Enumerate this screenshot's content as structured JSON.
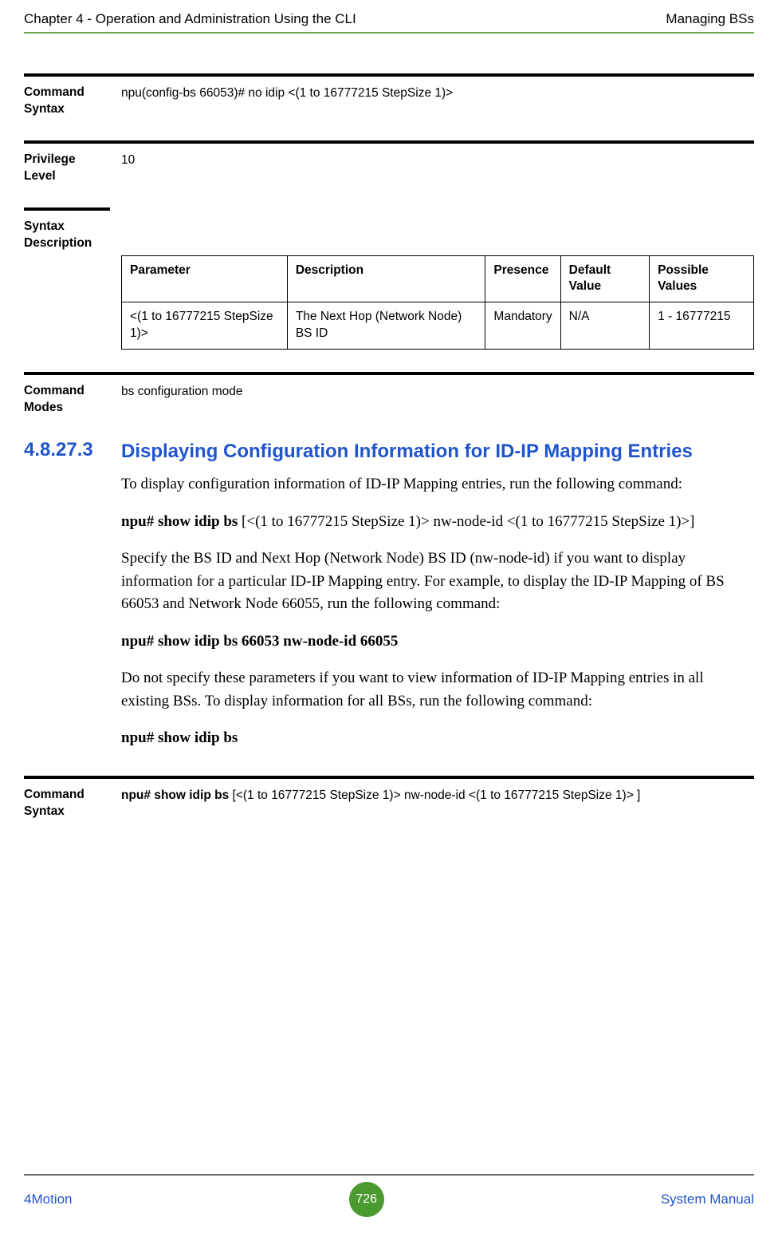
{
  "header": {
    "left": "Chapter 4 - Operation and Administration Using the CLI",
    "right": "Managing BSs"
  },
  "blocks": {
    "command_syntax_1": {
      "label": "Command Syntax",
      "value": "npu(config-bs 66053)#  no idip <(1 to 16777215 StepSize 1)>"
    },
    "privilege_level": {
      "label": "Privilege Level",
      "value": "10"
    },
    "syntax_description": {
      "label": "Syntax Description"
    },
    "command_modes": {
      "label": "Command Modes",
      "value": "bs configuration mode"
    },
    "command_syntax_2": {
      "label": "Command Syntax",
      "value_bold": "npu# show idip bs",
      "value_rest": " [<(1 to 16777215 StepSize 1)> nw-node-id <(1 to 16777215 StepSize 1)> ]"
    }
  },
  "param_table": {
    "headers": {
      "parameter": "Parameter",
      "description": "Description",
      "presence": "Presence",
      "default": "Default Value",
      "possible": "Possible Values"
    },
    "row": {
      "parameter": "<(1 to 16777215 StepSize 1)>",
      "description": "The Next Hop (Network Node) BS ID",
      "presence": "Mandatory",
      "default": "N/A",
      "possible": "1 - 16777215"
    }
  },
  "section": {
    "number": "4.8.27.3",
    "title": "Displaying Configuration Information for ID-IP Mapping Entries"
  },
  "paragraphs": {
    "p1": "To display configuration information of ID-IP Mapping entries, run the following command:",
    "p2_bold": "npu# show idip bs",
    "p2_rest": " [<(1 to 16777215 StepSize 1)> nw-node-id <(1 to 16777215 StepSize 1)>]",
    "p3": "Specify the BS ID and Next Hop (Network Node) BS ID (nw-node-id) if you want to display information for a particular ID-IP Mapping entry. For example, to display the ID-IP Mapping of BS 66053 and Network Node 66055, run the following command:",
    "p4_bold": "npu# show idip bs 66053 nw-node-id 66055",
    "p5": "Do not specify these parameters if you want to view information of ID-IP Mapping entries in all existing BSs. To display information for all BSs, run the following command:",
    "p6_bold": "npu# show idip bs"
  },
  "footer": {
    "left": "4Motion",
    "page": "726",
    "right": "System Manual"
  }
}
